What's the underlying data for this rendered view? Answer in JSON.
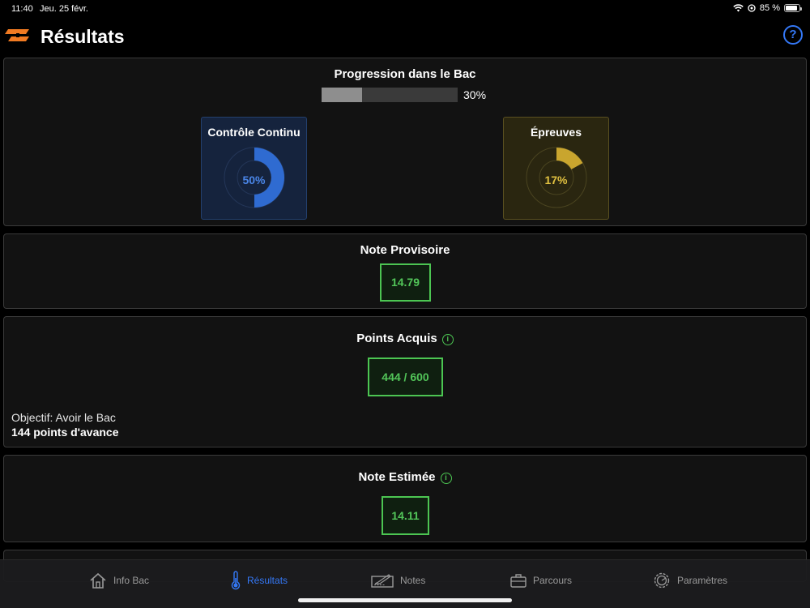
{
  "status": {
    "time": "11:40",
    "date": "Jeu. 25 févr.",
    "battery": "85 %"
  },
  "header": {
    "title": "Résultats",
    "help_label": "?"
  },
  "progression": {
    "title": "Progression dans le Bac",
    "percent_label": "30%",
    "percent": 0.3,
    "controle": {
      "title": "Contrôle Continu",
      "label": "50%",
      "value": 0.5,
      "color": "#2f6bd1"
    },
    "epreuves": {
      "title": "Épreuves",
      "label": "17%",
      "value": 0.17,
      "color": "#c9a52e"
    }
  },
  "note_provisoire": {
    "title": "Note Provisoire",
    "value": "14.79"
  },
  "points_acquis": {
    "title": "Points Acquis",
    "value": "444 / 600",
    "goal": "Objectif: Avoir le Bac",
    "advance": "144 points d'avance"
  },
  "note_estimee": {
    "title": "Note Estimée",
    "value": "14.11"
  },
  "tabs": [
    {
      "label": "Info Bac",
      "icon": "house-icon"
    },
    {
      "label": "Résultats",
      "icon": "thermometer-icon"
    },
    {
      "label": "Notes",
      "icon": "pen-line-icon"
    },
    {
      "label": "Parcours",
      "icon": "briefcase-icon"
    },
    {
      "label": "Paramètres",
      "icon": "gear-icon"
    }
  ],
  "colors": {
    "accent": "#3478f6",
    "success": "#4cc552"
  }
}
